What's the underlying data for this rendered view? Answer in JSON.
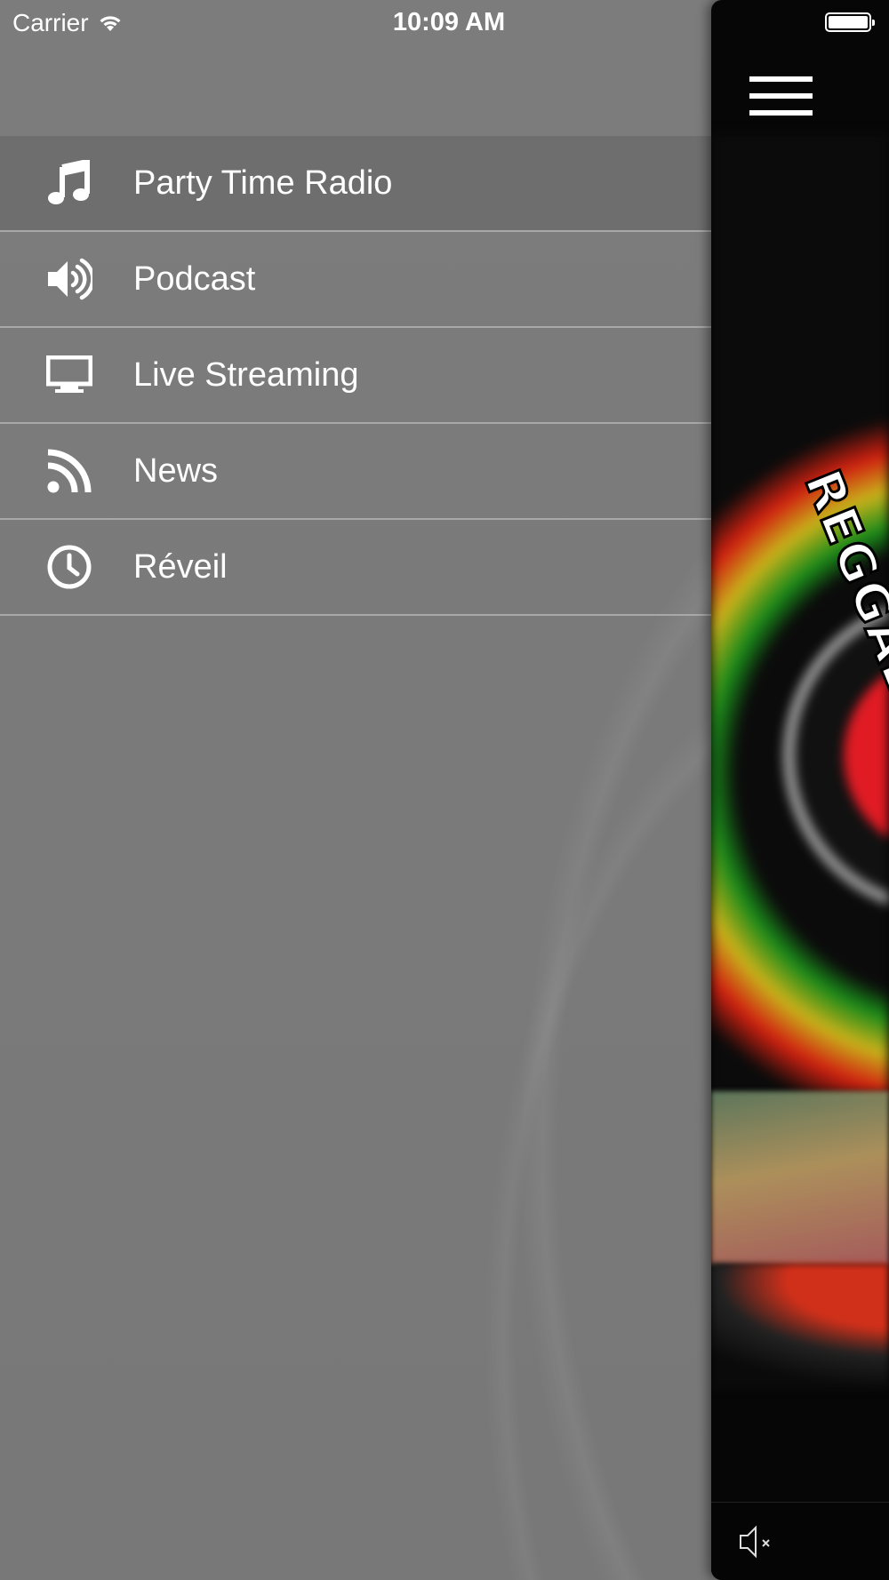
{
  "status_bar": {
    "carrier": "Carrier",
    "time": "10:09 AM",
    "wifi_icon": "wifi-icon",
    "battery_icon": "battery-icon"
  },
  "menu": {
    "items": [
      {
        "label": "Party Time Radio",
        "icon": "music-note-icon",
        "active": true
      },
      {
        "label": "Podcast",
        "icon": "speaker-volume-icon",
        "active": false
      },
      {
        "label": "Live Streaming",
        "icon": "monitor-icon",
        "active": false
      },
      {
        "label": "News",
        "icon": "rss-feed-icon",
        "active": false
      },
      {
        "label": "Réveil",
        "icon": "clock-icon",
        "active": false
      }
    ]
  },
  "main_panel": {
    "menu_icon": "hamburger-menu-icon",
    "artwork_text": "REGGAE D",
    "mute_icon": "speaker-mute-icon"
  },
  "colors": {
    "drawer_bg": "#7a7a7a",
    "active_item_bg": "#6e6e6e",
    "divider": "#a8a8a8",
    "panel_bg": "#060606"
  }
}
